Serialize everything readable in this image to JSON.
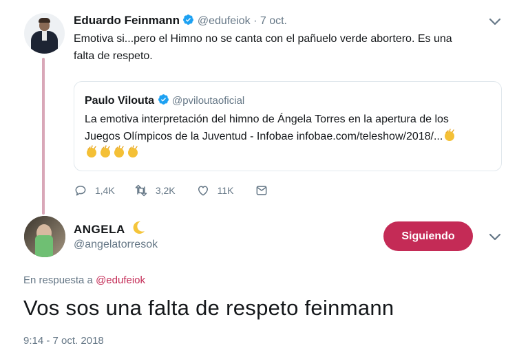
{
  "quoted_parent": {
    "author_name": "Eduardo Feinmann",
    "author_handle": "@edufeiok",
    "separator": "·",
    "date": "7 oct.",
    "text_line1": "Emotiva si...pero el Himno no se canta con el pañuelo verde abortero. Es una",
    "text_line2": "falta de respeto.",
    "quote": {
      "author_name": "Paulo Vilouta",
      "author_handle": "@pviloutaoficial",
      "text_line1": "La emotiva interpretación del himno de Ángela Torres en la apertura de los",
      "text_line2": "Juegos Olímpicos de la Juventud - Infobae infobae.com/teleshow/2018/..."
    },
    "actions": {
      "reply_count": "1,4K",
      "retweet_count": "3,2K",
      "like_count": "11K"
    }
  },
  "reply": {
    "author_name": "ANGELA",
    "author_handle": "@angelatorresok",
    "follow_label": "Siguiendo",
    "reply_to_prefix": "En respuesta a",
    "reply_to_mention": "@edufeiok",
    "text": "Vos sos una falta de respeto feinmann",
    "timestamp": "9:14 - 7 oct. 2018"
  },
  "colors": {
    "accent": "#c42b56",
    "verified": "#1da1f2",
    "thread_line": "#d9a7b8",
    "muted": "#657786"
  },
  "icons": [
    "verified-icon",
    "chevron-down-icon",
    "reply-icon",
    "retweet-icon",
    "like-icon",
    "message-icon",
    "clap-emoji",
    "crescent-moon-emoji"
  ]
}
